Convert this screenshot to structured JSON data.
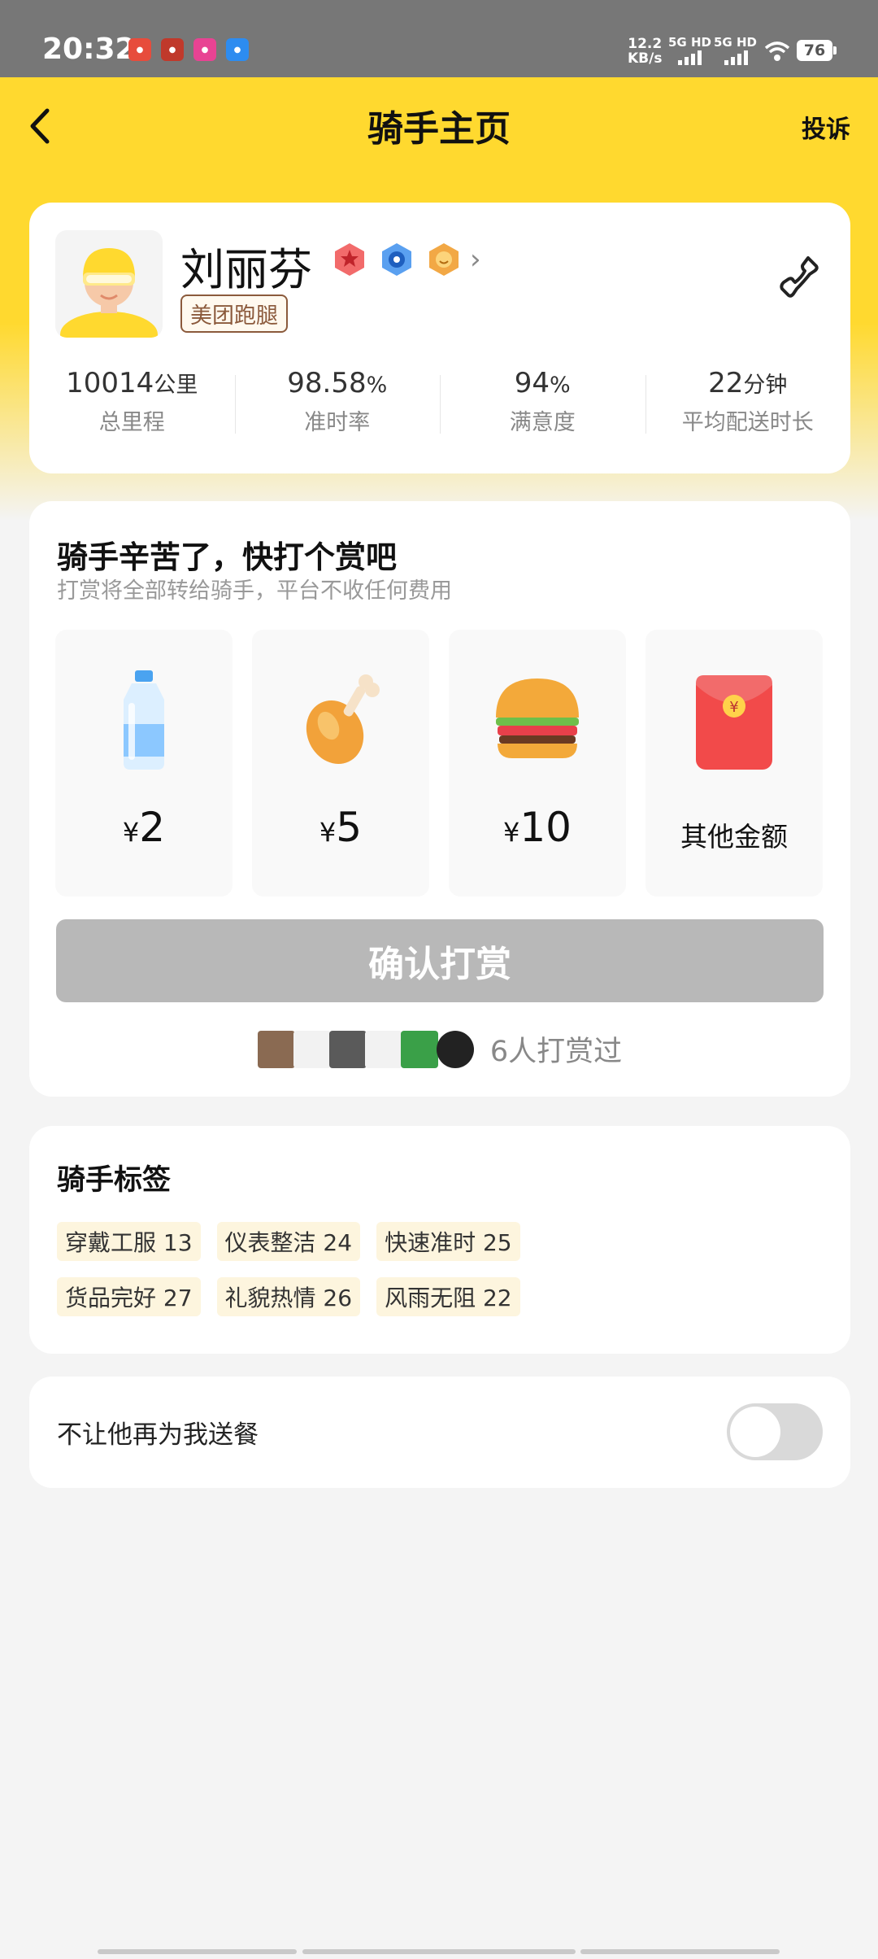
{
  "status_bar": {
    "time": "20:32",
    "speed_value": "12.2",
    "speed_unit": "KB/s",
    "network_1": "5G HD",
    "network_2": "5G HD",
    "battery": "76"
  },
  "header": {
    "title": "骑手主页",
    "complaint_label": "投诉"
  },
  "rider": {
    "name": "刘丽芬",
    "brand_tag": "美团跑腿",
    "stats": [
      {
        "value": "10014",
        "unit": "公里",
        "label": "总里程"
      },
      {
        "value": "98.58",
        "unit": "%",
        "label": "准时率"
      },
      {
        "value": "94",
        "unit": "%",
        "label": "满意度"
      },
      {
        "value": "22",
        "unit": "分钟",
        "label": "平均配送时长"
      }
    ]
  },
  "tip": {
    "title": "骑手辛苦了，快打个赏吧",
    "subtitle": "打赏将全部转给骑手，平台不收任何费用",
    "currency": "¥",
    "options": [
      {
        "amount": "2",
        "icon": "water-bottle-icon"
      },
      {
        "amount": "5",
        "icon": "chicken-leg-icon"
      },
      {
        "amount": "10",
        "icon": "burger-icon"
      },
      {
        "label": "其他金额",
        "icon": "red-envelope-icon"
      }
    ],
    "confirm_label": "确认打赏",
    "tippers_text": "6人打赏过"
  },
  "tags": {
    "title": "骑手标签",
    "items": [
      {
        "text": "穿戴工服 13"
      },
      {
        "text": "仪表整洁 24"
      },
      {
        "text": "快速准时 25"
      },
      {
        "text": "货品完好 27"
      },
      {
        "text": "礼貌热情 26"
      },
      {
        "text": "风雨无阻 22"
      }
    ]
  },
  "block": {
    "label": "不让他再为我送餐",
    "enabled": false
  },
  "colors": {
    "brand_yellow": "#ffd92f",
    "button_disabled": "#b8b8b8",
    "tag_bg": "#fdf5de"
  }
}
